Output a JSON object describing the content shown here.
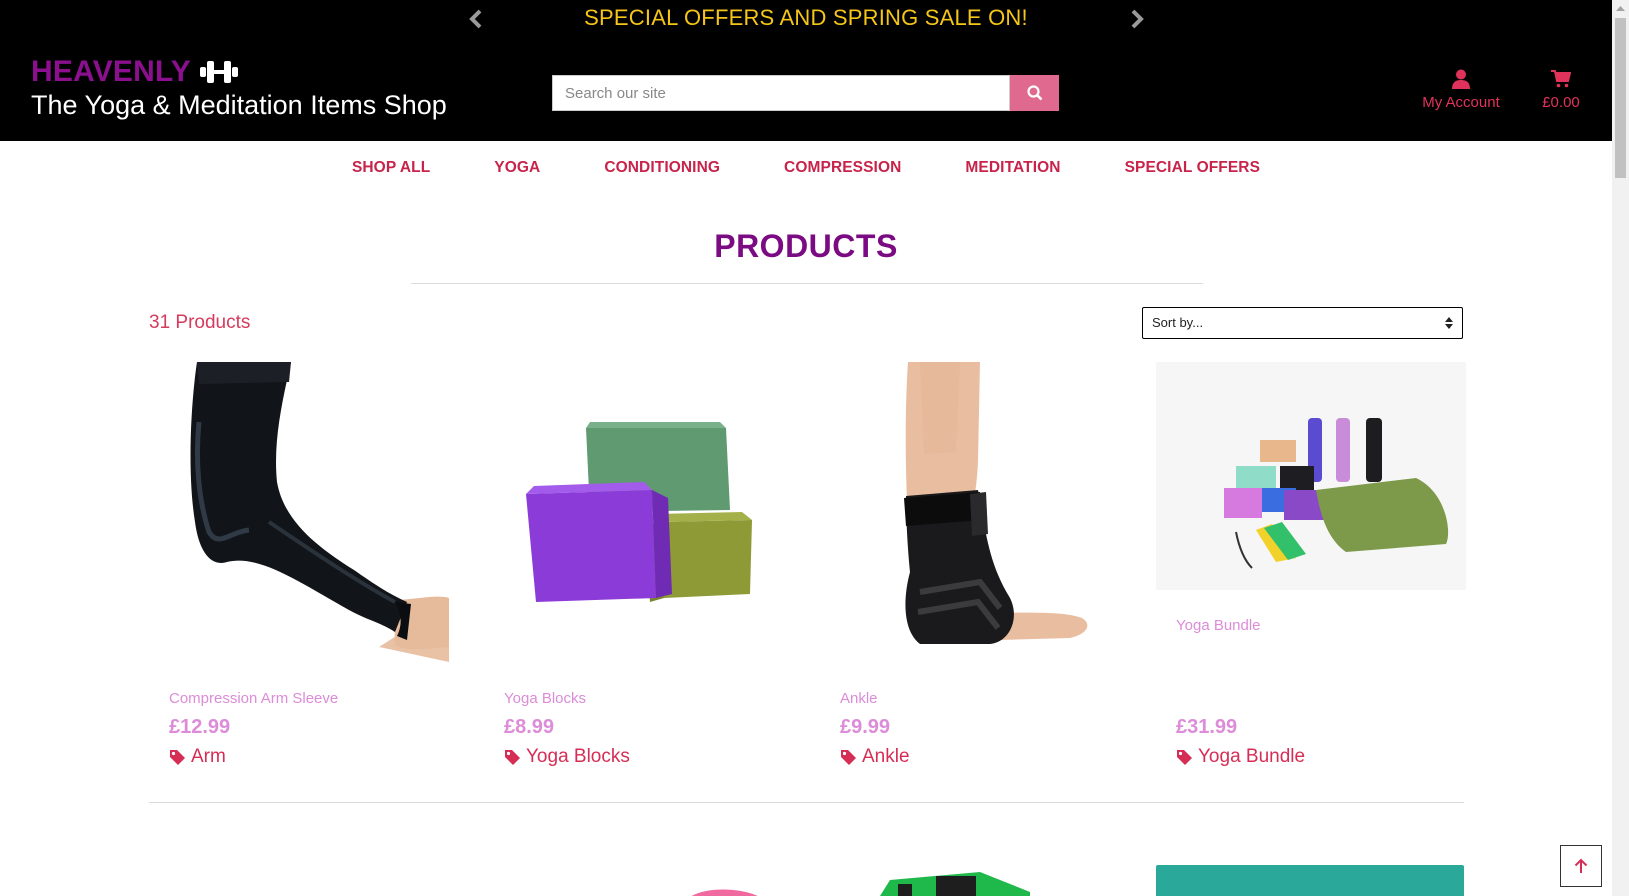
{
  "banner": {
    "text": "SPECIAL OFFERS AND SPRING SALE ON!"
  },
  "brand": {
    "name": "HEAVENLY",
    "tagline": "The Yoga & Meditation Items Shop"
  },
  "search": {
    "placeholder": "Search our site"
  },
  "account": {
    "label": "My Account"
  },
  "cart": {
    "total": "£0.00"
  },
  "nav": [
    "SHOP ALL",
    "YOGA",
    "CONDITIONING",
    "COMPRESSION",
    "MEDITATION",
    "SPECIAL OFFERS"
  ],
  "page_title": "PRODUCTS",
  "product_count": "31 Products",
  "sort": {
    "selected": "Sort by..."
  },
  "products": [
    {
      "name": "Compression Arm Sleeve",
      "price": "£12.99",
      "category": "Arm"
    },
    {
      "name": "Yoga Blocks",
      "price": "£8.99",
      "category": "Yoga Blocks"
    },
    {
      "name": "Ankle",
      "price": "£9.99",
      "category": "Ankle"
    },
    {
      "name": "Yoga Bundle",
      "price": "£31.99",
      "category": "Yoga Bundle"
    }
  ],
  "colors": {
    "brand_purple": "#8b0f8f",
    "accent_pink": "#e0325a",
    "banner_yellow": "#f5c518",
    "product_name_pink": "#dc8cd8"
  },
  "icons": [
    "chevron-left-icon",
    "chevron-right-icon",
    "dumbbell-icon",
    "search-icon",
    "user-icon",
    "cart-icon",
    "tag-icon",
    "sort-caret-icon",
    "arrow-up-icon"
  ]
}
